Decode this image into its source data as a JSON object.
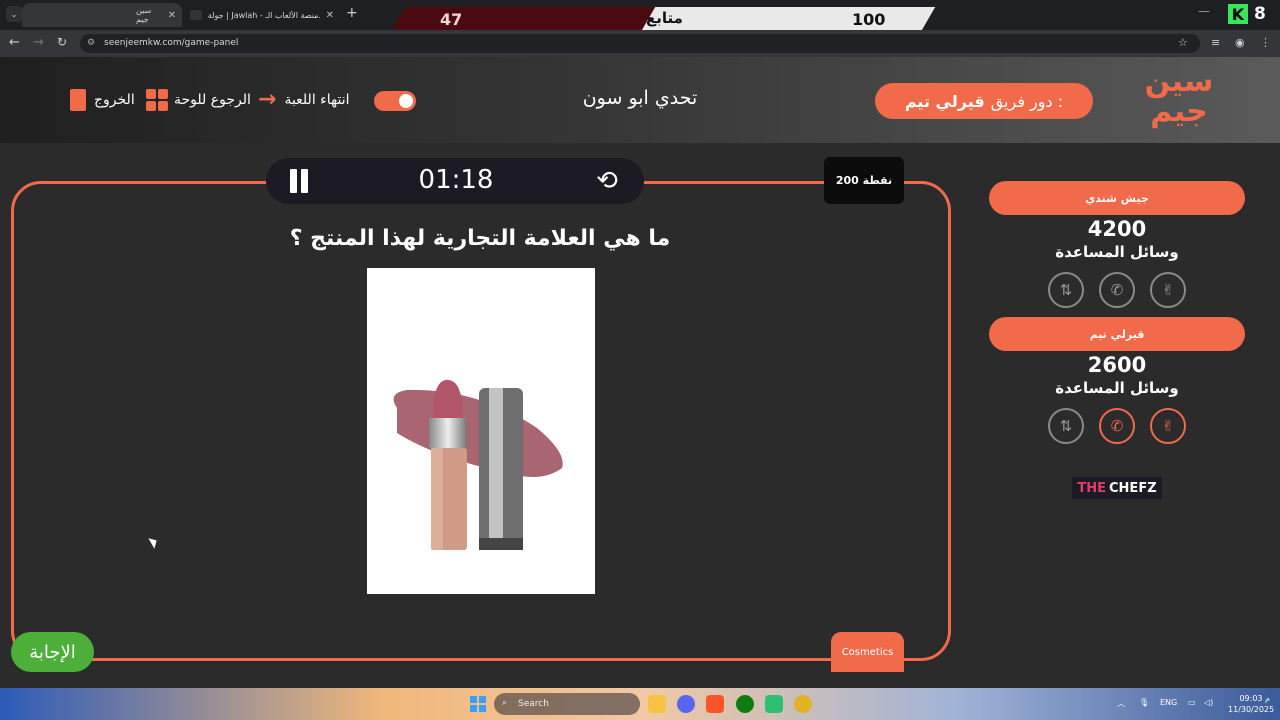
{
  "browser": {
    "tabs": [
      {
        "title": "سين جيم",
        "active": true
      },
      {
        "title": "جولة | Jawlah - منصة الألعاب الـ...",
        "active": false
      }
    ],
    "new_tab": "+",
    "tab_close": "✕",
    "url": "seenjeemkw.com/game-panel"
  },
  "overlay": {
    "left_score": "47",
    "center_label": "متابع",
    "right_score": "100",
    "k_count": "8",
    "k_letter": "K"
  },
  "header": {
    "exit_label": "الخروج",
    "board_label": "الرجوع للوحة",
    "end_label": "انتهاء اللعبة",
    "game_title": "تحدي ابو سون",
    "turn_prefix": "دور فريق :",
    "turn_team": "قيرلي تيم",
    "brand_line1": "سين",
    "brand_line2": "جيم"
  },
  "question": {
    "timer": "01:18",
    "points": "200 نقطة",
    "text": "ما هي العلامة التجارية لهذا المنتج ؟",
    "category": "Cosmetics",
    "answer_label": "الإجابة"
  },
  "teams": [
    {
      "name": "جيش شندي",
      "score": "4200",
      "aids_label": "وسائل المساعدة",
      "aids_active": [
        false,
        false,
        false
      ]
    },
    {
      "name": "قيرلي تيم",
      "score": "2600",
      "aids_label": "وسائل المساعدة",
      "aids_active": [
        true,
        true,
        false
      ]
    }
  ],
  "sponsor": {
    "part1": "THE",
    "part2": "CHEFZ"
  },
  "taskbar": {
    "search_placeholder": "Search",
    "lang": "ENG",
    "time": "09:03 م",
    "date": "11/30/2025"
  },
  "colors": {
    "accent": "#f16a4a",
    "answer_green": "#4caf3a",
    "timer_bg": "#1c1b24"
  }
}
